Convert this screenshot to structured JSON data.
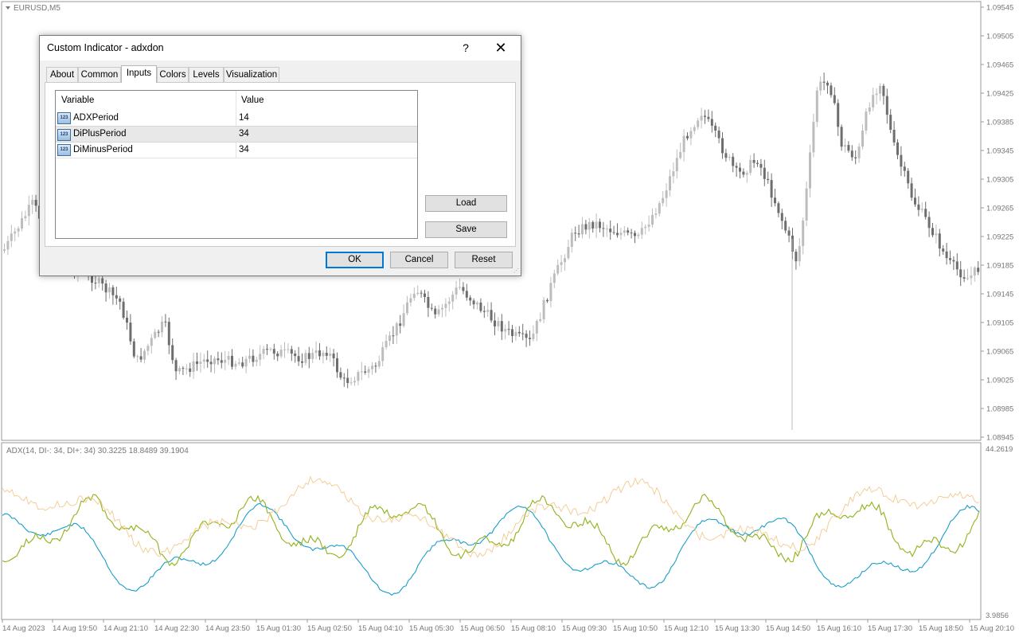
{
  "chart": {
    "symbol_label": "EURUSD,M5",
    "price_axis": [
      "1.09545",
      "1.09505",
      "1.09465",
      "1.09425",
      "1.09385",
      "1.09345",
      "1.09305",
      "1.09265",
      "1.09225",
      "1.09185",
      "1.09145",
      "1.09105",
      "1.09065",
      "1.09025",
      "1.08985",
      "1.08945"
    ],
    "time_axis": [
      "14 Aug 2023",
      "14 Aug 19:50",
      "14 Aug 21:10",
      "14 Aug 22:30",
      "14 Aug 23:50",
      "15 Aug 01:30",
      "15 Aug 02:50",
      "15 Aug 04:10",
      "15 Aug 05:30",
      "15 Aug 06:50",
      "15 Aug 08:10",
      "15 Aug 09:30",
      "15 Aug 10:50",
      "15 Aug 12:10",
      "15 Aug 13:30",
      "15 Aug 14:50",
      "15 Aug 16:10",
      "15 Aug 17:30",
      "15 Aug 18:50",
      "15 Aug 20:10"
    ],
    "colors": {
      "bull": "#bdbdbd",
      "bear": "#6e6e6e",
      "grid": "#c8c8c8",
      "axis_text": "#777777"
    }
  },
  "indicator": {
    "label": "ADX(14, DI-: 34, DI+: 34) 30.3225 18.8489 39.1904",
    "scale_max": "44.2619",
    "scale_min": "3.9856",
    "lines": [
      {
        "name": "ADX",
        "color": "#1a9ec9"
      },
      {
        "name": "DI+",
        "color": "#8fb21a"
      },
      {
        "name": "DI-",
        "color": "#f3c98e"
      }
    ]
  },
  "dialog": {
    "title": "Custom Indicator - adxdon",
    "help_glyph": "?",
    "close_glyph": "✕",
    "tabs": [
      "About",
      "Common",
      "Inputs",
      "Colors",
      "Levels",
      "Visualization"
    ],
    "active_tab": "Inputs",
    "grid": {
      "columns": [
        "Variable",
        "Value"
      ],
      "rows": [
        {
          "variable": "ADXPeriod",
          "value": "14"
        },
        {
          "variable": "DiPlusPeriod",
          "value": "34"
        },
        {
          "variable": "DiMinusPeriod",
          "value": "34"
        }
      ],
      "row_icon_text": "123"
    },
    "side_buttons": {
      "load": "Load",
      "save": "Save"
    },
    "buttons": {
      "ok": "OK",
      "cancel": "Cancel",
      "reset": "Reset"
    }
  }
}
